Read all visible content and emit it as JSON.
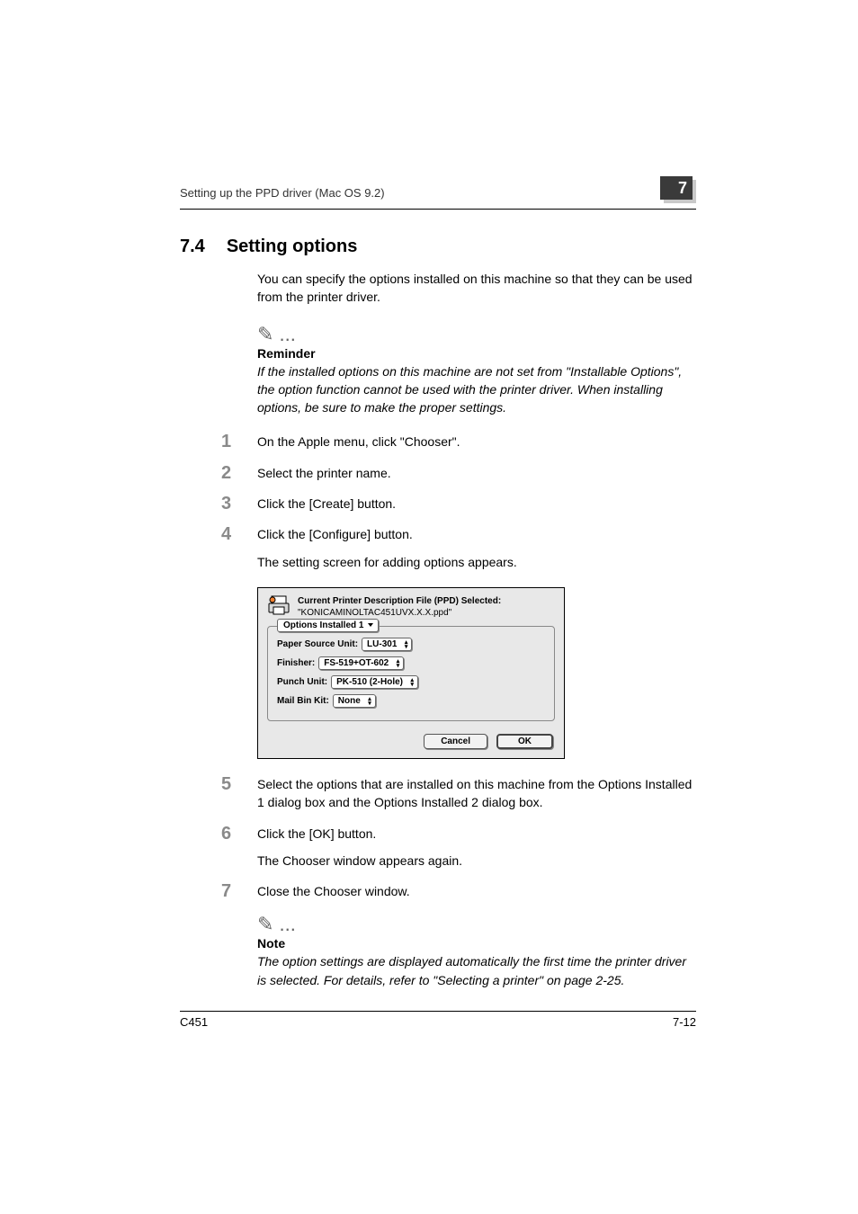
{
  "header": {
    "running_title": "Setting up the PPD driver (Mac OS 9.2)",
    "chapter_number": "7"
  },
  "section": {
    "number": "7.4",
    "title": "Setting options",
    "intro": "You can specify the options installed on this machine so that they can be used from the printer driver."
  },
  "reminder": {
    "label": "Reminder",
    "text": "If the installed options on this machine are not set from \"Installable Options\", the option function cannot be used with the printer driver. When installing options, be sure to make the proper settings."
  },
  "steps": [
    {
      "text": "On the Apple menu, click \"Chooser\"."
    },
    {
      "text": "Select the printer name."
    },
    {
      "text": "Click the [Create] button."
    },
    {
      "text": "Click the [Configure] button.",
      "sub": "The setting screen for adding options appears."
    },
    {
      "text": "Select the options that are installed on this machine from the Options Installed 1 dialog box and the Options Installed 2 dialog box."
    },
    {
      "text": "Click the [OK] button.",
      "sub": "The Chooser window appears again."
    },
    {
      "text": "Close the Chooser window."
    }
  ],
  "dialog": {
    "title_line1": "Current Printer Description File (PPD) Selected:",
    "title_line2": "\"KONICAMINOLTAC451UVX.X.X.ppd\"",
    "group_label": "Options Installed 1",
    "rows": {
      "paper_source_label": "Paper Source Unit:",
      "paper_source_value": "LU-301",
      "finisher_label": "Finisher:",
      "finisher_value": "FS-519+OT-602",
      "punch_label": "Punch Unit:",
      "punch_value": "PK-510 (2-Hole)",
      "mailbin_label": "Mail Bin Kit:",
      "mailbin_value": "None"
    },
    "buttons": {
      "cancel": "Cancel",
      "ok": "OK"
    }
  },
  "note": {
    "label": "Note",
    "text": "The option settings are displayed automatically the first time the printer driver is selected. For details, refer to \"Selecting a printer\" on page 2-25."
  },
  "footer": {
    "model": "C451",
    "page": "7-12"
  }
}
